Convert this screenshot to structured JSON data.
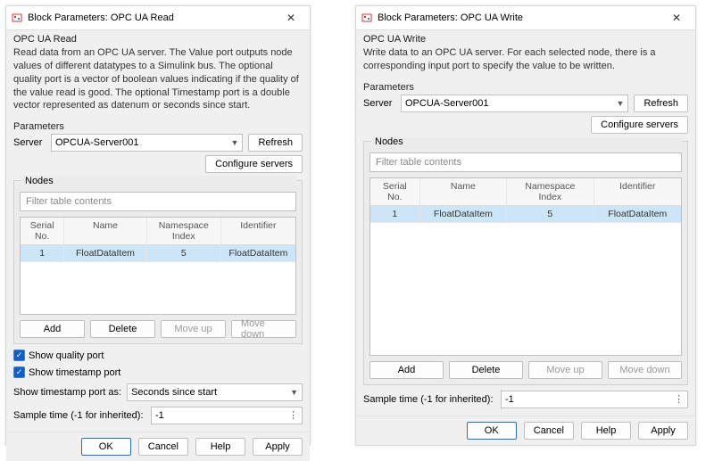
{
  "leftDialog": {
    "title": "Block Parameters: OPC UA Read",
    "blockName": "OPC UA Read",
    "description": "Read data from an OPC UA server. The Value port outputs node values of different datatypes to a Simulink bus. The optional quality port is a vector of boolean values indicating if the quality of the value read is good. The optional Timestamp port is a double vector represented as datenum or seconds since start.",
    "parametersLabel": "Parameters",
    "serverLabel": "Server",
    "serverValue": "OPCUA-Server001",
    "refreshLabel": "Refresh",
    "configureServersLabel": "Configure servers",
    "nodesLabel": "Nodes",
    "filterPlaceholder": "Filter table contents",
    "columns": {
      "serial": "Serial No.",
      "name": "Name",
      "ns": "Namespace Index",
      "id": "Identifier"
    },
    "rows": [
      {
        "serial": "1",
        "name": "FloatDataItem",
        "ns": "5",
        "id": "FloatDataItem"
      }
    ],
    "addLabel": "Add",
    "deleteLabel": "Delete",
    "moveUpLabel": "Move up",
    "moveDownLabel": "Move down",
    "showQualityLabel": "Show quality port",
    "showTimestampLabel": "Show timestamp port",
    "showTimestampAsLabel": "Show timestamp port as:",
    "showTimestampAsValue": "Seconds since start",
    "sampleTimeLabel": "Sample time (-1 for inherited):",
    "sampleTimeValue": "-1",
    "okLabel": "OK",
    "cancelLabel": "Cancel",
    "helpLabel": "Help",
    "applyLabel": "Apply"
  },
  "rightDialog": {
    "title": "Block Parameters: OPC UA Write",
    "blockName": "OPC UA Write",
    "description": "Write data to an OPC UA server. For each selected node, there is a corresponding input port to specify the value to be written.",
    "parametersLabel": "Parameters",
    "serverLabel": "Server",
    "serverValue": "OPCUA-Server001",
    "refreshLabel": "Refresh",
    "configureServersLabel": "Configure servers",
    "nodesLabel": "Nodes",
    "filterPlaceholder": "Filter table contents",
    "columns": {
      "serial": "Serial No.",
      "name": "Name",
      "ns": "Namespace Index",
      "id": "Identifier"
    },
    "rows": [
      {
        "serial": "1",
        "name": "FloatDataItem",
        "ns": "5",
        "id": "FloatDataItem"
      }
    ],
    "addLabel": "Add",
    "deleteLabel": "Delete",
    "moveUpLabel": "Move up",
    "moveDownLabel": "Move down",
    "sampleTimeLabel": "Sample time (-1 for inherited):",
    "sampleTimeValue": "-1",
    "okLabel": "OK",
    "cancelLabel": "Cancel",
    "helpLabel": "Help",
    "applyLabel": "Apply"
  }
}
